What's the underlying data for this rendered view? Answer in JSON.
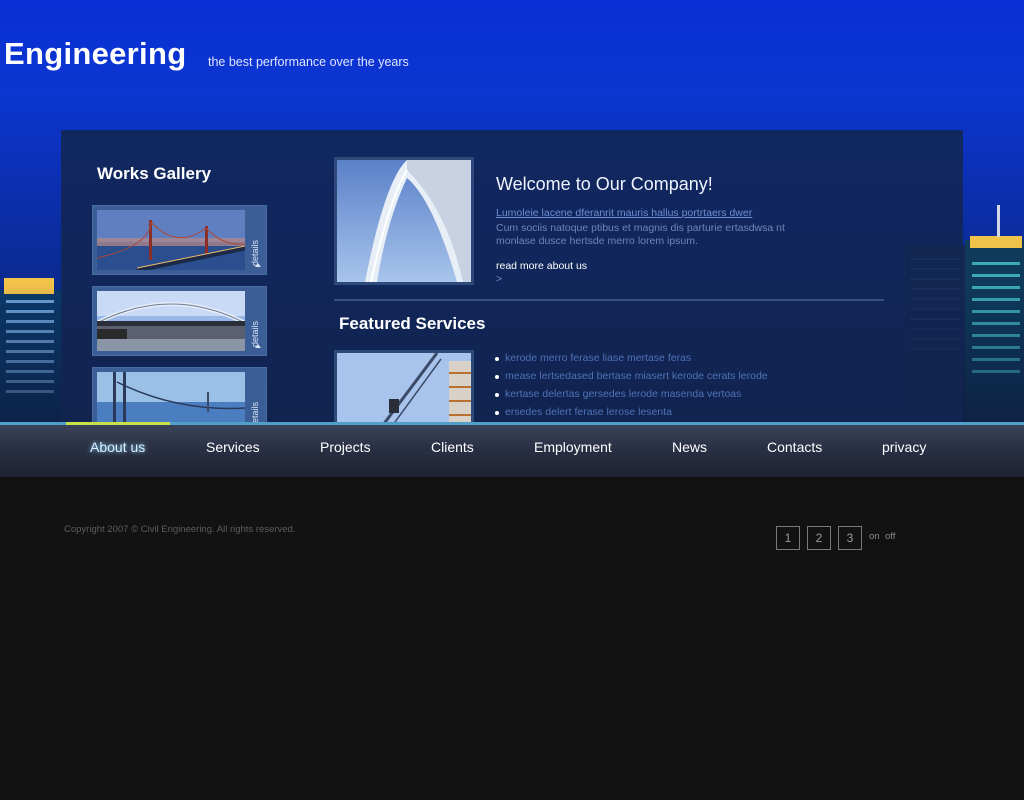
{
  "header": {
    "title": "Engineering",
    "tagline": "the best performance over the years"
  },
  "gallery": {
    "title": "Works Gallery",
    "items": [
      {
        "image": "golden-gate-bridge-dusk",
        "details_label": "details"
      },
      {
        "image": "arch-bridge",
        "details_label": "details"
      },
      {
        "image": "suspension-bridge-blue",
        "details_label": "details"
      }
    ]
  },
  "welcome": {
    "title": "Welcome to Our Company!",
    "link": "Lumoleie lacene dferanrit mauris hallus portrtaers dwer",
    "body": "Cum sociis natoque ptibus et magnis dis parturie ertasdwsa nt monlase dusce hertsde merro lorem ipsum.",
    "read_more": "read more about us",
    "read_more_arrow": ">"
  },
  "featured": {
    "title": "Featured Services",
    "items": [
      "kerode merro ferase liase mertase feras",
      "mease lertsedased bertase miasert kerode cerats lerode",
      "kertase delertas gersedes lerode masenda vertoas",
      "ersedes delert ferase lerose lesenta"
    ]
  },
  "nav": {
    "items": [
      "About us",
      "Services",
      "Projects",
      "Clients",
      "Employment",
      "News",
      "Contacts",
      "privacy"
    ],
    "active_index": 0
  },
  "footer": {
    "copyright": "Copyright 2007 © Civil Engineering. All rights reserved.",
    "pages": [
      "1",
      "2",
      "3"
    ],
    "on_label": "on",
    "off_label": "off"
  },
  "colors": {
    "sky": "#0a2fd6",
    "panel": "#122652",
    "nav_accent": "#4fa0c8",
    "active_bar": "#c9e24a"
  }
}
